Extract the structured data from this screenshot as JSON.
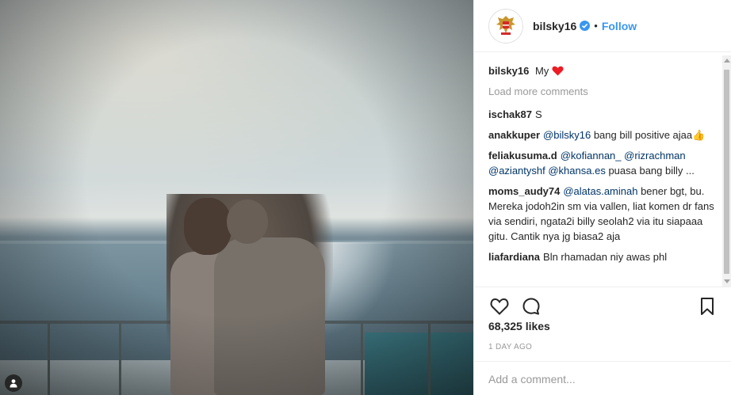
{
  "post": {
    "username": "bilsky16",
    "follow_label": "Follow",
    "dot": "•",
    "caption": {
      "user": "bilsky16",
      "text": "My"
    },
    "load_more": "Load more comments",
    "likes": "68,325 likes",
    "time_ago": "1 DAY AGO",
    "add_comment_placeholder": "Add a comment..."
  },
  "comments": [
    {
      "user": "ischak87",
      "parts": [
        {
          "t": "S"
        }
      ]
    },
    {
      "user": "anakkuper",
      "parts": [
        {
          "m": "@bilsky16"
        },
        {
          "t": " bang bill positive ajaa"
        }
      ],
      "emoji": "👍"
    },
    {
      "user": "feliakusuma.d",
      "parts": [
        {
          "m": "@kofiannan_"
        },
        {
          "t": " "
        },
        {
          "m": "@rizrachman"
        },
        {
          "t": " "
        },
        {
          "m": "@aziantyshf"
        },
        {
          "t": " "
        },
        {
          "m": "@khansa.es"
        },
        {
          "t": " puasa bang billy ..."
        }
      ]
    },
    {
      "user": "moms_audy74",
      "parts": [
        {
          "m": "@alatas.aminah"
        },
        {
          "t": " bener bgt, bu. Mereka jodoh2in sm via vallen, liat komen dr fans via sendiri, ngata2i billy seolah2 via itu siapaaa gitu. Cantik nya jg biasa2 aja"
        }
      ]
    },
    {
      "user": "liafardiana",
      "parts": [
        {
          "t": "Bln rhamadan niy awas phl"
        }
      ]
    }
  ],
  "colors": {
    "accent": "#3897f0",
    "mention": "#003569",
    "heart": "#ed1c24",
    "muted": "#999999"
  },
  "icons": {
    "avatar": "garuda-emblem-icon",
    "verified": "verified-badge-icon",
    "like": "heart-outline-icon",
    "comment": "comment-bubble-icon",
    "save": "bookmark-icon",
    "tag": "user-tag-icon",
    "caption_emoji": "red-heart-emoji"
  }
}
